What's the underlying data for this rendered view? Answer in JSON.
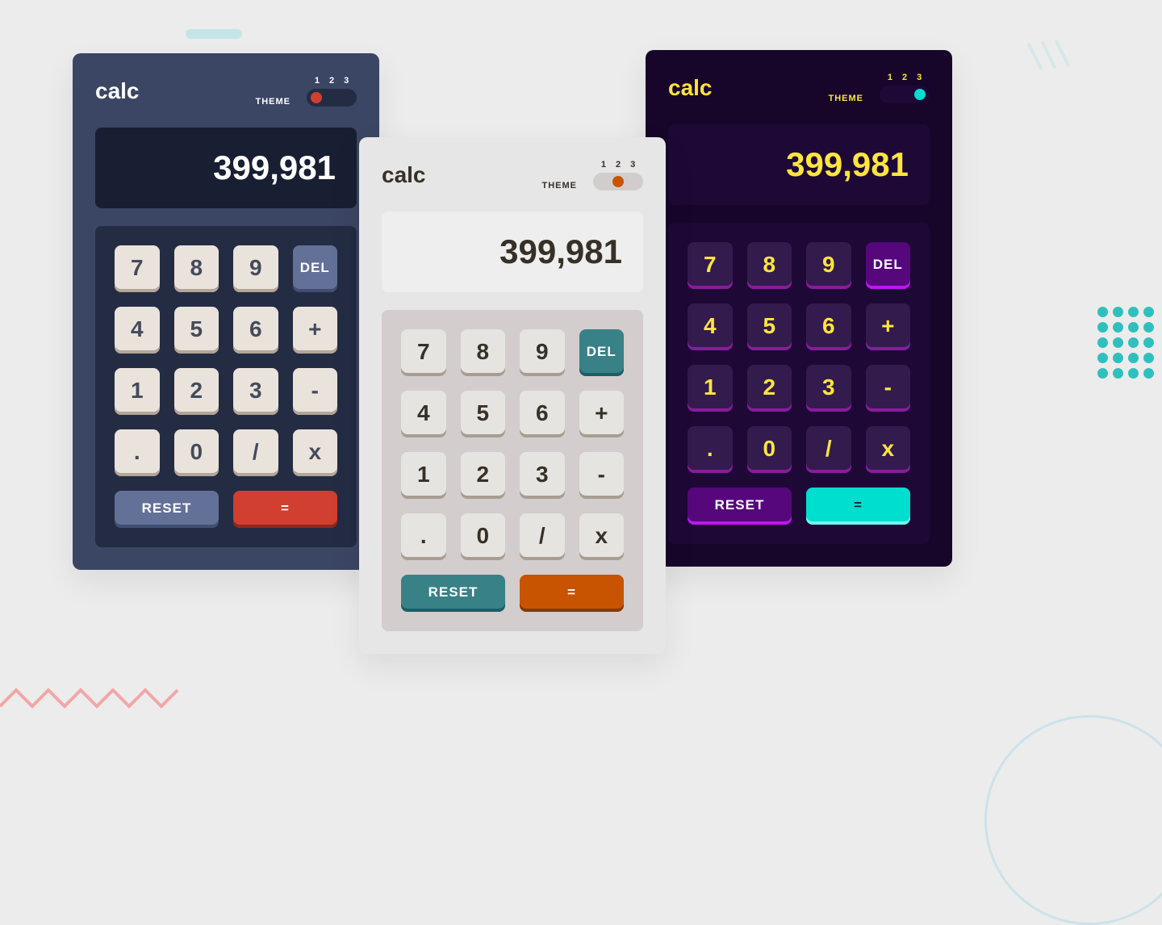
{
  "logo": "calc",
  "theme_label": "THEME",
  "theme_options": {
    "a": "1",
    "b": "2",
    "c": "3"
  },
  "display_value": "399,981",
  "keys": {
    "seven": "7",
    "eight": "8",
    "nine": "9",
    "del": "DEL",
    "four": "4",
    "five": "5",
    "six": "6",
    "plus": "+",
    "one": "1",
    "two": "2",
    "three": "3",
    "minus": "-",
    "dot": ".",
    "zero": "0",
    "divide": "/",
    "multiply": "x",
    "reset": "RESET",
    "equals": "="
  }
}
